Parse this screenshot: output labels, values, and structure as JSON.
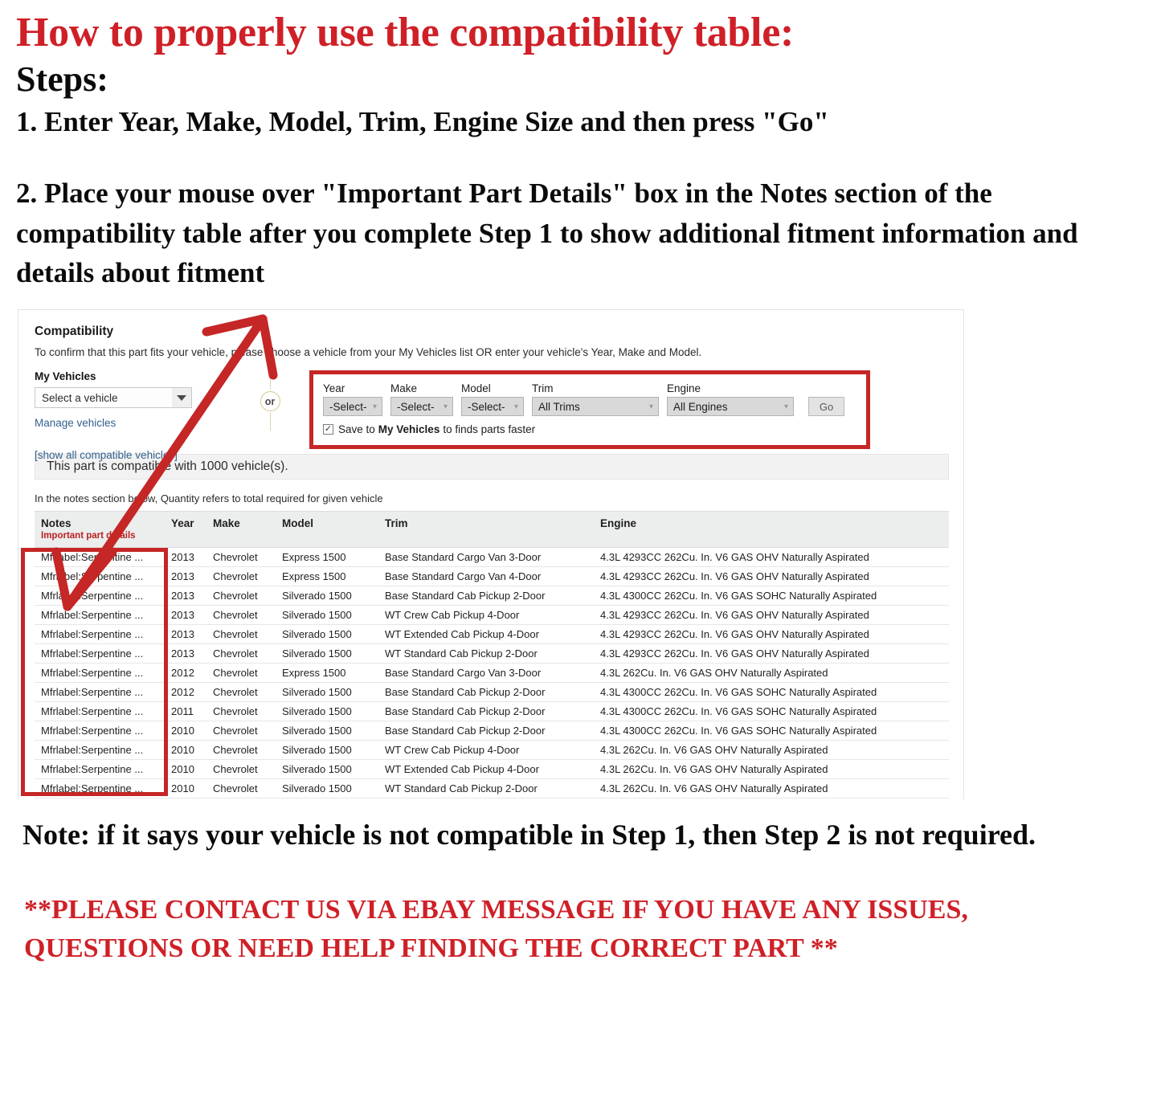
{
  "header": {
    "title": "How to properly use the compatibility table:",
    "steps_label": "Steps:",
    "step1": "1. Enter Year, Make, Model, Trim, Engine Size and then press \"Go\"",
    "step2": "2. Place your mouse over \"Important Part Details\" box in the Notes section of the compatibility table after you complete Step 1 to show additional fitment information and details about fitment"
  },
  "panel": {
    "title": "Compatibility",
    "subtitle": "To confirm that this part fits your vehicle, please choose a vehicle from your My Vehicles list OR enter your vehicle's Year, Make and Model.",
    "my_vehicles_label": "My Vehicles",
    "vehicle_select_value": "Select a vehicle",
    "manage_vehicles_link": "Manage vehicles",
    "show_all_link": "[show all compatible vehicles]",
    "or_divider": "or",
    "fields": {
      "year_label": "Year",
      "year_value": "-Select-",
      "make_label": "Make",
      "make_value": "-Select-",
      "model_label": "Model",
      "model_value": "-Select-",
      "trim_label": "Trim",
      "trim_value": "All Trims",
      "engine_label": "Engine",
      "engine_value": "All Engines",
      "go_button": "Go"
    },
    "save_checkbox": {
      "checked_glyph": "✓",
      "text_before": "Save to",
      "bold_text": "My Vehicles",
      "text_after": "to finds parts faster"
    },
    "compat_banner": "This part is compatible with 1000 vehicle(s).",
    "notes_hint": "In the notes section below, Quantity refers to total required for given vehicle"
  },
  "table": {
    "columns": [
      "Notes",
      "Year",
      "Make",
      "Model",
      "Trim",
      "Engine"
    ],
    "notes_sub_header": "Important part details",
    "rows": [
      {
        "notes": "Mfrlabel:Serpentine ...",
        "year": "2013",
        "make": "Chevrolet",
        "model": "Express 1500",
        "trim": "Base Standard Cargo Van 3-Door",
        "engine": "4.3L 4293CC 262Cu. In. V6 GAS OHV Naturally Aspirated"
      },
      {
        "notes": "Mfrlabel:Serpentine ...",
        "year": "2013",
        "make": "Chevrolet",
        "model": "Express 1500",
        "trim": "Base Standard Cargo Van 4-Door",
        "engine": "4.3L 4293CC 262Cu. In. V6 GAS OHV Naturally Aspirated"
      },
      {
        "notes": "Mfrlabel:Serpentine ...",
        "year": "2013",
        "make": "Chevrolet",
        "model": "Silverado 1500",
        "trim": "Base Standard Cab Pickup 2-Door",
        "engine": "4.3L 4300CC 262Cu. In. V6 GAS SOHC Naturally Aspirated"
      },
      {
        "notes": "Mfrlabel:Serpentine ...",
        "year": "2013",
        "make": "Chevrolet",
        "model": "Silverado 1500",
        "trim": "WT Crew Cab Pickup 4-Door",
        "engine": "4.3L 4293CC 262Cu. In. V6 GAS OHV Naturally Aspirated"
      },
      {
        "notes": "Mfrlabel:Serpentine ...",
        "year": "2013",
        "make": "Chevrolet",
        "model": "Silverado 1500",
        "trim": "WT Extended Cab Pickup 4-Door",
        "engine": "4.3L 4293CC 262Cu. In. V6 GAS OHV Naturally Aspirated"
      },
      {
        "notes": "Mfrlabel:Serpentine ...",
        "year": "2013",
        "make": "Chevrolet",
        "model": "Silverado 1500",
        "trim": "WT Standard Cab Pickup 2-Door",
        "engine": "4.3L 4293CC 262Cu. In. V6 GAS OHV Naturally Aspirated"
      },
      {
        "notes": "Mfrlabel:Serpentine ...",
        "year": "2012",
        "make": "Chevrolet",
        "model": "Express 1500",
        "trim": "Base Standard Cargo Van 3-Door",
        "engine": "4.3L 262Cu. In. V6 GAS OHV Naturally Aspirated"
      },
      {
        "notes": "Mfrlabel:Serpentine ...",
        "year": "2012",
        "make": "Chevrolet",
        "model": "Silverado 1500",
        "trim": "Base Standard Cab Pickup 2-Door",
        "engine": "4.3L 4300CC 262Cu. In. V6 GAS SOHC Naturally Aspirated"
      },
      {
        "notes": "Mfrlabel:Serpentine ...",
        "year": "2011",
        "make": "Chevrolet",
        "model": "Silverado 1500",
        "trim": "Base Standard Cab Pickup 2-Door",
        "engine": "4.3L 4300CC 262Cu. In. V6 GAS SOHC Naturally Aspirated"
      },
      {
        "notes": "Mfrlabel:Serpentine ...",
        "year": "2010",
        "make": "Chevrolet",
        "model": "Silverado 1500",
        "trim": "Base Standard Cab Pickup 2-Door",
        "engine": "4.3L 4300CC 262Cu. In. V6 GAS SOHC Naturally Aspirated"
      },
      {
        "notes": "Mfrlabel:Serpentine ...",
        "year": "2010",
        "make": "Chevrolet",
        "model": "Silverado 1500",
        "trim": "WT Crew Cab Pickup 4-Door",
        "engine": "4.3L 262Cu. In. V6 GAS OHV Naturally Aspirated"
      },
      {
        "notes": "Mfrlabel:Serpentine ...",
        "year": "2010",
        "make": "Chevrolet",
        "model": "Silverado 1500",
        "trim": "WT Extended Cab Pickup 4-Door",
        "engine": "4.3L 262Cu. In. V6 GAS OHV Naturally Aspirated"
      },
      {
        "notes": "Mfrlabel:Serpentine ...",
        "year": "2010",
        "make": "Chevrolet",
        "model": "Silverado 1500",
        "trim": "WT Standard Cab Pickup 2-Door",
        "engine": "4.3L 262Cu. In. V6 GAS OHV Naturally Aspirated"
      }
    ]
  },
  "footer": {
    "note": "Note: if it says your vehicle is not compatible in Step 1, then Step 2 is not required.",
    "contact": "**PLEASE CONTACT US VIA EBAY MESSAGE IF YOU HAVE ANY ISSUES, QUESTIONS OR NEED HELP FINDING THE CORRECT PART **"
  },
  "colors": {
    "accent_red": "#cf2027",
    "annotation_red": "#c52626",
    "link_blue": "#35618e"
  }
}
